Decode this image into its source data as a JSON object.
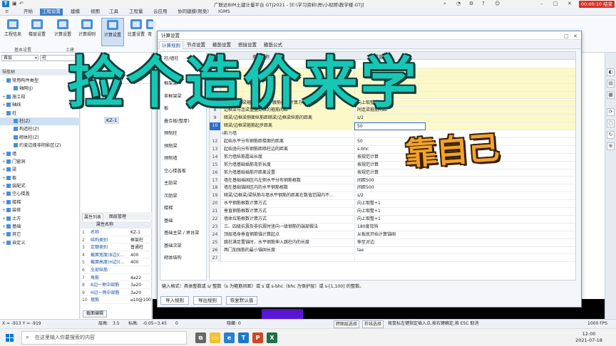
{
  "window": {
    "logo": "T",
    "title": "广联达BIM土建计量平台 GTJ2021 - [E:\\学习资料\\亮\\小视频\\教学楼.GTJ]",
    "recording": "00:00:10 结束"
  },
  "menu": {
    "tabs": [
      "开始",
      "工程设置",
      "建模",
      "视图",
      "工具",
      "工程量",
      "云应用",
      "协同建模(限免)",
      "IGMS"
    ],
    "active": "工程设置"
  },
  "ribbon": {
    "buttons": [
      "工程信息",
      "楼层设置",
      "计算设置",
      "计算规则",
      "计算设置",
      "比重设置",
      "弯"
    ],
    "active": "计算设置",
    "groups": [
      "基本设置",
      "土建"
    ]
  },
  "left_pane": {
    "floor_combo": "首层",
    "type_combo": "柱",
    "nav_title": "导航树",
    "tree": [
      {
        "label": "常用构件类型",
        "toggle": "-",
        "indent": 0
      },
      {
        "label": "轴网(J)",
        "toggle": "",
        "indent": 1
      },
      {
        "label": "施工段",
        "toggle": "+",
        "indent": 0
      },
      {
        "label": "轴线",
        "toggle": "+",
        "indent": 0
      },
      {
        "label": "柱",
        "toggle": "-",
        "indent": 0
      },
      {
        "label": "柱(Z)",
        "toggle": "",
        "indent": 1,
        "selected": true
      },
      {
        "label": "构造柱(Z)",
        "toggle": "",
        "indent": 1
      },
      {
        "label": "砌体柱(Z)",
        "toggle": "",
        "indent": 1
      },
      {
        "label": "约束边缘非阴影区(Z)",
        "toggle": "",
        "indent": 1
      },
      {
        "label": "墙",
        "toggle": "+",
        "indent": 0
      },
      {
        "label": "门窗洞",
        "toggle": "+",
        "indent": 0
      },
      {
        "label": "梁",
        "toggle": "+",
        "indent": 0
      },
      {
        "label": "板",
        "toggle": "+",
        "indent": 0
      },
      {
        "label": "装配式",
        "toggle": "+",
        "indent": 0
      },
      {
        "label": "空心楼盖",
        "toggle": "+",
        "indent": 0
      },
      {
        "label": "楼梯",
        "toggle": "+",
        "indent": 0
      },
      {
        "label": "装修",
        "toggle": "+",
        "indent": 0
      },
      {
        "label": "土方",
        "toggle": "+",
        "indent": 0
      },
      {
        "label": "基础",
        "toggle": "+",
        "indent": 0
      },
      {
        "label": "其它",
        "toggle": "+",
        "indent": 0
      },
      {
        "label": "自定义",
        "toggle": "+",
        "indent": 0
      }
    ]
  },
  "mid_pane": {
    "toolbar_label": "删除",
    "item": "KZ-1"
  },
  "properties": {
    "tabs": [
      "属性列表",
      "图层管理"
    ],
    "header": "属性名称",
    "rows": [
      {
        "n": "1",
        "k": "名称",
        "v": "KZ-1"
      },
      {
        "n": "2",
        "k": "结构类别",
        "v": "框架柱"
      },
      {
        "n": "3",
        "k": "定额类别",
        "v": "普通柱"
      },
      {
        "n": "4",
        "k": "截面宽度(B边)(...",
        "v": "400"
      },
      {
        "n": "5",
        "k": "截面高度(H边)(...",
        "v": "400"
      },
      {
        "n": "6",
        "k": "全部纵筋",
        "v": ""
      },
      {
        "n": "7",
        "k": "角筋",
        "v": "4⌀22"
      },
      {
        "n": "8",
        "k": "B边一侧中部筋",
        "v": "3⌀20"
      },
      {
        "n": "9",
        "k": "H边一侧中部筋",
        "v": "3⌀20"
      },
      {
        "n": "10",
        "k": "箍筋",
        "v": "⌀10@100"
      }
    ],
    "button": "截面编辑"
  },
  "dialog": {
    "title": "计算设置",
    "tabs": [
      "计算规则",
      "节点设置",
      "箍筋设置",
      "搭接设置",
      "箍筋公式"
    ],
    "active_tab": "计算规则",
    "list": [
      "柱/墙柱",
      "连梁",
      "框架梁",
      "非框架梁",
      "板",
      "叠合板(整厚)",
      "预制柱",
      "预制梁",
      "预制墙",
      "空心楼盖板",
      "主肋梁",
      "次肋梁",
      "楼梯",
      "基础",
      "基础主梁 / 承台梁",
      "基础次梁",
      "砌体结构"
    ],
    "header_name": "类型名称",
    "header_value": "设置值",
    "rows": [
      {
        "n": "1",
        "name": "",
        "value": "",
        "yellow": false,
        "group": true
      },
      {
        "n": "3",
        "name": "端...",
        "value": "",
        "yellow": true
      },
      {
        "n": "4",
        "name": "",
        "value": "",
        "yellow": true
      },
      {
        "n": "5",
        "name": "",
        "value": "",
        "yellow": true
      },
      {
        "n": "6",
        "name": "",
        "value": "",
        "yellow": true
      },
      {
        "n": "7",
        "name": "暗梁/边框梁箍筋、拉筋、腰筋根数计算方式",
        "value": "向上取整+1",
        "yellow": true
      },
      {
        "n": "8",
        "name": "边框梁与连梁重叠部位的箍筋间距",
        "value": "同连梁箍筋间距",
        "yellow": true
      },
      {
        "n": "9",
        "name": "暗梁/边框梁侧面纵筋距暗梁/边框梁纵筋的距离",
        "value": "s/2",
        "yellow": true
      },
      {
        "n": "10",
        "name": "暗梁/边框梁箍筋起步距离",
        "value": "50",
        "yellow": true,
        "current": true
      },
      {
        "n": "",
        "name": "剪力墙",
        "value": "",
        "yellow": false,
        "group": true
      },
      {
        "n": "12",
        "name": "起始水平分布钢筋距楼面的距离",
        "value": "50",
        "yellow": false
      },
      {
        "n": "13",
        "name": "起始竖向分布钢筋距暗柱边的距离",
        "value": "s-bhc",
        "yellow": false
      },
      {
        "n": "14",
        "name": "剪力墙纵筋露出长度",
        "value": "按规范计算",
        "yellow": false
      },
      {
        "n": "15",
        "name": "剪力墙基础插筋弯折长度",
        "value": "按规范计算",
        "yellow": false
      },
      {
        "n": "16",
        "name": "剪力墙基础插筋开距离设置",
        "value": "按规范计算",
        "yellow": false
      },
      {
        "n": "17",
        "name": "墙在基础插固区内左侧水平分布钢筋根数",
        "value": "间距500",
        "yellow": false
      },
      {
        "n": "18",
        "name": "墙在基础锚固区内的水平钢筋根数",
        "value": "间距500",
        "yellow": false
      },
      {
        "n": "19",
        "name": "暗梁/边框梁/梁纵筋与墙水平钢筋的距离在数值范围内不...",
        "value": "s/2",
        "yellow": false
      },
      {
        "n": "20",
        "name": "水平钢筋根数计算方式",
        "value": "向上取整+1",
        "yellow": false
      },
      {
        "n": "21",
        "name": "垂直钢筋根数计算方式",
        "value": "向上取整+1",
        "yellow": false
      },
      {
        "n": "22",
        "name": "墙体拉筋根数计算方式",
        "value": "向上取整+1",
        "yellow": false
      },
      {
        "n": "23",
        "name": "三、四级抗震及非抗震时竖向一级钢筋的端部做法",
        "value": "180度弯钩",
        "yellow": false
      },
      {
        "n": "24",
        "name": "顶层墙身垂直钢筋锚计算起点",
        "value": "从板底开始计算锚固",
        "yellow": false
      },
      {
        "n": "25",
        "name": "跳柱满足置锚时，水平钢筋伸入跳柱内的长度",
        "value": "伸至对边",
        "yellow": false
      },
      {
        "n": "26",
        "name": "两门加强筋的最小锚固长度",
        "value": "lae",
        "yellow": false
      },
      {
        "n": "27",
        "name": "",
        "value": "",
        "yellow": false
      }
    ],
    "note": "输入格式：具体整数或 s/ 整数（s 为箍筋间距）或 s 或 s-bhc（bhc 为保护层）或 s-[1,100] 的整数。",
    "buttons": [
      "导入规则",
      "导出规则",
      "恢复默认值"
    ]
  },
  "status": {
    "coords": "X = -913 Y = -919",
    "floor_height_label": "层高:",
    "floor_height": "3.5",
    "elevation_label": "标高:",
    "elevation": "-0.05~3.45",
    "count": "0",
    "hidden_label": "隐藏:",
    "hidden": "0",
    "cross_layer": "跨图层选择",
    "polyline": "折线选择",
    "hint": "按鼠标左键指定插入点,按右键确定,按 ESC 取消",
    "fps": "1000 FPS"
  },
  "taskbar": {
    "search_placeholder": "在这里输入你要搜索的内容",
    "time": "12:00",
    "date": "2021-07-18"
  },
  "overlay": {
    "main": "捡个造价来学",
    "sub": "靠自己"
  }
}
